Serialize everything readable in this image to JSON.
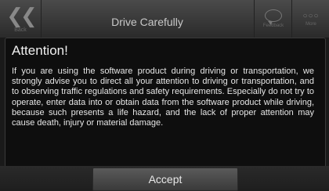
{
  "header": {
    "title": "Drive Carefully",
    "back_label": "Back",
    "right_buttons": [
      {
        "label": "Feedback",
        "icon": "speech-bubble-icon"
      },
      {
        "label": "More",
        "icon": "more-dots-icon"
      }
    ]
  },
  "dialog": {
    "title": "Attention!",
    "body": "If you are using the software product during driving or transportation, we strongly advise you to direct all your attention to driving or transportation, and to observing traffic regulations and safety requirements. Especially do not try to operate, enter data into or obtain data from the software product while driving, because such presents a life hazard, and the lack of proper attention may cause death, injury or material damage."
  },
  "footer": {
    "accept_label": "Accept"
  },
  "colors": {
    "background": "#1a1a1a",
    "dialog_bg": "#0e0e0e",
    "button": "#4a4a4a"
  }
}
